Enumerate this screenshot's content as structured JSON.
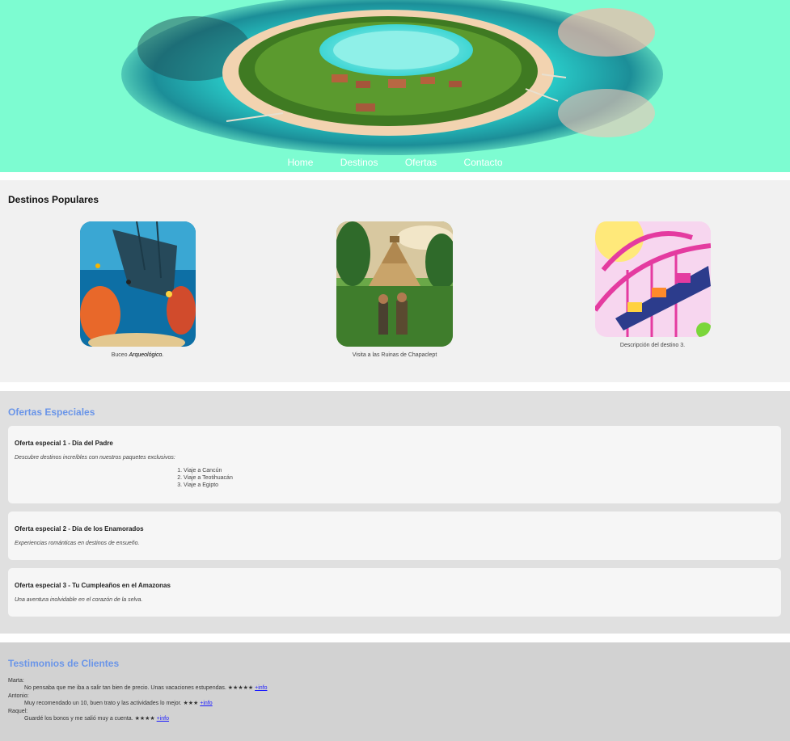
{
  "nav": {
    "items": [
      "Home",
      "Destinos",
      "Ofertas",
      "Contacto"
    ]
  },
  "colors": {
    "header_bg": "#7dfcd1",
    "heading_blue": "#6a95e8"
  },
  "destinations": {
    "title": "Destinos Populares",
    "items": [
      {
        "caption_prefix": "Buceo ",
        "caption_em": "Arqueológico.",
        "image": "underwater-shipwreck"
      },
      {
        "caption": "Visita a las Ruinas de Chapaclept",
        "image": "mayan-pyramid-ruins"
      },
      {
        "caption": "Descripción del destino 3.",
        "image": "roller-coaster"
      }
    ]
  },
  "offers": {
    "title": "Ofertas Especiales",
    "items": [
      {
        "title": "Oferta especial 1 - Día del Padre",
        "desc": "Descubre destinos increíbles con nuestros paquetes exclusivos:",
        "list": [
          "Viaje a Cancún",
          "Viaje a Teotihuacán",
          "Viaje a Egipto"
        ]
      },
      {
        "title": "Oferta especial 2 - Día de los Enamorados",
        "desc": "Experiencias románticas en destinos de ensueño."
      },
      {
        "title": "Oferta especial 3 - Tu Cumpleaños en el Amazonas",
        "desc": "Una aventura inolvidable en el corazón de la selva."
      }
    ]
  },
  "testimonials": {
    "title": "Testimonios de Clientes",
    "items": [
      {
        "name": "Marta:",
        "quote": "No pensaba que me iba a salir tan bien de precio. Unas vacaciones estupendas. ★★★★★",
        "link": "+info"
      },
      {
        "name": "Antonio:",
        "quote": "Muy recomendado un 10, buen trato y las actividades lo mejor. ★★★",
        "link": "+info"
      },
      {
        "name": "Raquel:",
        "quote": "Guardé los bonos y me salió muy a cuenta. ★★★★",
        "link": "+info"
      }
    ]
  }
}
